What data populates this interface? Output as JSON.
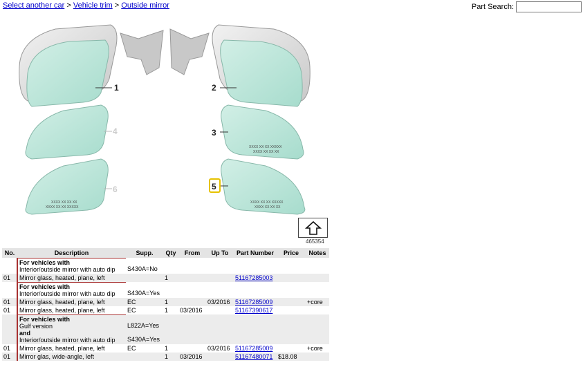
{
  "breadcrumb": {
    "items": [
      "Select another car",
      "Vehicle trim",
      "Outside mirror"
    ],
    "separator": ">"
  },
  "search": {
    "label": "Part Search:",
    "value": ""
  },
  "diagram": {
    "callouts": [
      "1",
      "2",
      "3",
      "4",
      "5",
      "6"
    ],
    "highlighted_callout": "5",
    "glass_markings": {
      "part3": [
        "XXXX XX XX XXXXX",
        "XXXX XX XX XX"
      ],
      "part5": [
        "XXXX XX XX XXXXX",
        "XXXX XX XX XX"
      ],
      "part6": [
        "XXXX XX XX XX",
        "XXXX XX XX XXXXX"
      ]
    },
    "figure_number": "465354",
    "up_icon": "up-arrow-icon"
  },
  "table": {
    "headers": [
      "No.",
      "Description",
      "Supp.",
      "Qty",
      "From",
      "Up To",
      "Part Number",
      "Price",
      "Notes"
    ],
    "rows": [
      {
        "kind": "cond",
        "lines": [
          {
            "text": "For vehicles with",
            "bold": true,
            "supp": ""
          },
          {
            "text": "Interior/outside mirror with auto dip",
            "bold": false,
            "supp": "S430A=No"
          }
        ]
      },
      {
        "kind": "part",
        "no": "01",
        "desc": "Mirror glass, heated, plane, left",
        "supp": "",
        "qty": "1",
        "from": "",
        "upto": "",
        "part": "51167285003",
        "price": "",
        "notes": ""
      },
      {
        "kind": "cond",
        "lines": [
          {
            "text": "For vehicles with",
            "bold": true,
            "supp": ""
          },
          {
            "text": "Interior/outside mirror with auto dip",
            "bold": false,
            "supp": "S430A=Yes"
          }
        ]
      },
      {
        "kind": "part",
        "no": "01",
        "desc": "Mirror glass, heated, plane, left",
        "supp": "EC",
        "qty": "1",
        "from": "",
        "upto": "03/2016",
        "part": "51167285009",
        "price": "",
        "notes": "+core"
      },
      {
        "kind": "part",
        "no": "01",
        "desc": "Mirror glass, heated, plane, left",
        "supp": "EC",
        "qty": "1",
        "from": "03/2016",
        "upto": "",
        "part": "51167390617",
        "price": "",
        "notes": "",
        "white": true
      },
      {
        "kind": "cond",
        "grey": true,
        "lines": [
          {
            "text": "For vehicles with",
            "bold": true,
            "supp": ""
          },
          {
            "text": "Gulf version",
            "bold": false,
            "supp": "L822A=Yes"
          },
          {
            "text": "and",
            "bold": true,
            "supp": ""
          },
          {
            "text": "Interior/outside mirror with auto dip",
            "bold": false,
            "supp": "S430A=Yes"
          }
        ]
      },
      {
        "kind": "part",
        "no": "01",
        "desc": "Mirror glass, heated, plane, left",
        "supp": "EC",
        "qty": "1",
        "from": "",
        "upto": "03/2016",
        "part": "51167285009",
        "price": "",
        "notes": "+core",
        "white": true
      },
      {
        "kind": "part",
        "no": "01",
        "desc": "Mirror glas, wide-angle, left",
        "supp": "",
        "qty": "1",
        "from": "03/2016",
        "upto": "",
        "part": "51167480071",
        "price": "$18.08",
        "notes": ""
      }
    ]
  }
}
